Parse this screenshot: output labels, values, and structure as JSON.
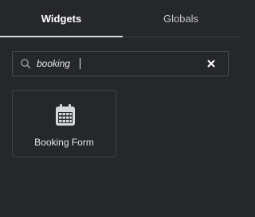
{
  "tabs": [
    {
      "label": "Widgets",
      "active": true
    },
    {
      "label": "Globals",
      "active": false
    }
  ],
  "search": {
    "value": "booking",
    "icon": "search-icon",
    "clear_icon": "close-icon"
  },
  "widgets": [
    {
      "label": "Booking Form",
      "icon": "calendar-icon"
    }
  ],
  "colors": {
    "background": "#26272b",
    "active_tab_text": "#ffffff",
    "inactive_tab_text": "#c3c5c9",
    "border": "#4b4d52",
    "card_border": "#3f4147",
    "text": "#e6e8ea"
  }
}
